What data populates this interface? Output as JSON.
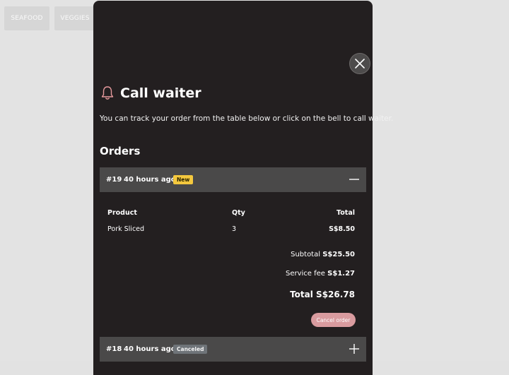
{
  "categories": [
    "SEAFOOD",
    "VEGGIES"
  ],
  "modal": {
    "title": "Call waiter",
    "description": "You can track your order from the table below or click on the bell to call waiter.",
    "orders_heading": "Orders",
    "colors": {
      "background": "#231f20",
      "order_bar": "#4a4949",
      "accent": "#e79a9d",
      "badge_new": "#f4c83e",
      "badge_canceled": "#6f7479"
    }
  },
  "orders": [
    {
      "number": "#19",
      "time": "40 hours ago",
      "status": "New",
      "expanded": true,
      "table": {
        "headers": {
          "product": "Product",
          "qty": "Qty",
          "total": "Total"
        },
        "rows": [
          {
            "product": "Pork Sliced",
            "qty": "3",
            "total": "S$8.50"
          }
        ]
      },
      "subtotal_label": "Subtotal",
      "subtotal_value": "S$25.50",
      "service_fee_label": "Service fee",
      "service_fee_value": "S$1.27",
      "total_label": "Total",
      "total_value": "S$26.78",
      "cancel_label": "Cancel order"
    },
    {
      "number": "#18",
      "time": "40 hours ago",
      "status": "Canceled",
      "expanded": false
    }
  ],
  "icons": {
    "close": "close-icon",
    "bell": "bell-icon",
    "collapse": "minus-icon",
    "expand": "plus-icon"
  }
}
